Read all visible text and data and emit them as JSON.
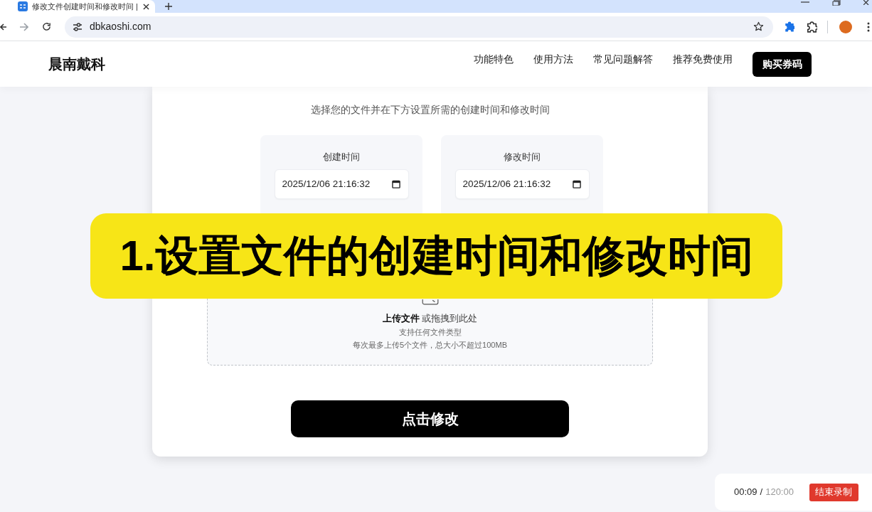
{
  "browser": {
    "tabs": [
      {
        "title": "修改文件创建时间和修改时间 |",
        "selected": true
      }
    ],
    "address": "dbkaoshi.com"
  },
  "header": {
    "logo": "晨南戴科",
    "nav": [
      {
        "label": "功能特色"
      },
      {
        "label": "使用方法"
      },
      {
        "label": "常见问题解答"
      },
      {
        "label": "推荐免费使用"
      }
    ],
    "cta": "购买券码"
  },
  "form": {
    "subtitle": "选择您的文件并在下方设置所需的创建时间和修改时间",
    "time_fields": [
      {
        "label": "创建时间",
        "value": "2025/12/06 21:16:32"
      },
      {
        "label": "修改时间",
        "value": "2025/12/06 21:16:32"
      }
    ],
    "upload": {
      "prompt": "**上传文件** 或拖拽到此处",
      "hint": "支持任何文件类型",
      "limit": "每次最多上传5个文件，总大小不超过100MB"
    },
    "submit": "点击修改"
  },
  "caption": "1.设置文件的创建时间和修改时间",
  "recorder": {
    "elapsed": "00:09",
    "separator": "/",
    "limit": "120:00",
    "stop": "结束录制"
  }
}
